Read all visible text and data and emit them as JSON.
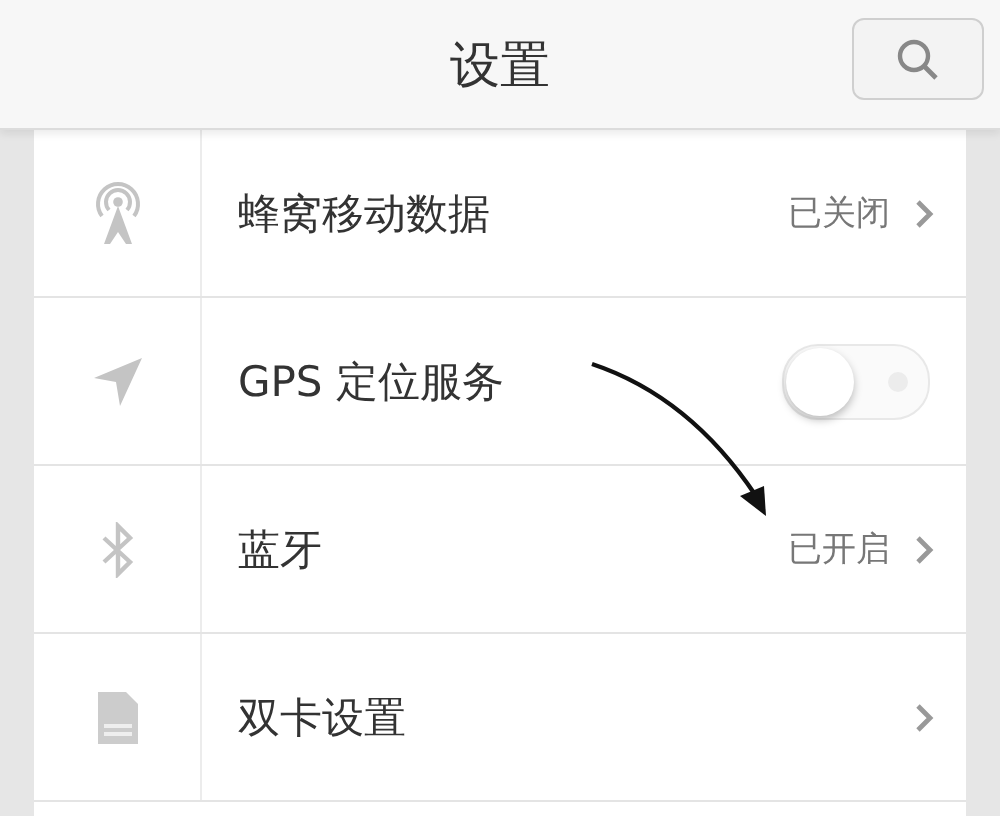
{
  "header": {
    "title": "设置"
  },
  "rows": [
    {
      "kind": "link",
      "label": "蜂窝移动数据",
      "value": "已关闭"
    },
    {
      "kind": "toggle",
      "label": "GPS 定位服务",
      "on": false
    },
    {
      "kind": "link",
      "label": "蓝牙",
      "value": "已开启"
    },
    {
      "kind": "link",
      "label": "双卡设置"
    }
  ]
}
